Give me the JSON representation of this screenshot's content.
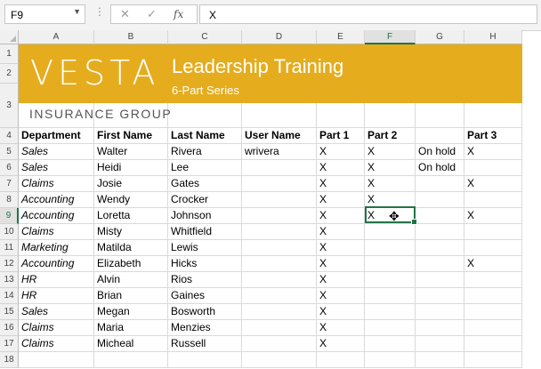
{
  "formula_bar": {
    "name_box": "F9",
    "cancel_icon": "✕",
    "enter_icon": "✓",
    "fx_label": "fx",
    "content": "X"
  },
  "columns": [
    "A",
    "B",
    "C",
    "D",
    "E",
    "F",
    "G",
    "H"
  ],
  "rows": [
    "1",
    "2",
    "3",
    "4",
    "5",
    "6",
    "7",
    "8",
    "9",
    "10",
    "11",
    "12",
    "13",
    "14",
    "15",
    "16",
    "17",
    "18"
  ],
  "banner": {
    "logo": "VESTA",
    "title": "Leadership Training",
    "subtitle": "6-Part Series",
    "company": "INSURANCE GROUP",
    "color": "#e5ac1d"
  },
  "headers": [
    "Department",
    "First Name",
    "Last Name",
    "User Name",
    "Part 1",
    "Part 2",
    "",
    "Part 3"
  ],
  "table": [
    [
      "Sales",
      "Walter",
      "Rivera",
      "wrivera",
      "X",
      "X",
      "On hold",
      "X"
    ],
    [
      "Sales",
      "Heidi",
      "Lee",
      "",
      "X",
      "X",
      "On hold",
      ""
    ],
    [
      "Claims",
      "Josie",
      "Gates",
      "",
      "X",
      "X",
      "",
      "X"
    ],
    [
      "Accounting",
      "Wendy",
      "Crocker",
      "",
      "X",
      "X",
      "",
      ""
    ],
    [
      "Accounting",
      "Loretta",
      "Johnson",
      "",
      "X",
      "X",
      "",
      "X"
    ],
    [
      "Claims",
      "Misty",
      "Whitfield",
      "",
      "X",
      "",
      "",
      ""
    ],
    [
      "Marketing",
      "Matilda",
      "Lewis",
      "",
      "X",
      "",
      "",
      ""
    ],
    [
      "Accounting",
      "Elizabeth",
      "Hicks",
      "",
      "X",
      "",
      "",
      "X"
    ],
    [
      "HR",
      "Alvin",
      "Rios",
      "",
      "X",
      "",
      "",
      ""
    ],
    [
      "HR",
      "Brian",
      "Gaines",
      "",
      "X",
      "",
      "",
      ""
    ],
    [
      "Sales",
      "Megan",
      "Bosworth",
      "",
      "X",
      "",
      "",
      ""
    ],
    [
      "Claims",
      "Maria",
      "Menzies",
      "",
      "X",
      "",
      "",
      ""
    ],
    [
      "Claims",
      "Micheal",
      "Russell",
      "",
      "X",
      "",
      "",
      ""
    ]
  ],
  "accent": "#217346"
}
